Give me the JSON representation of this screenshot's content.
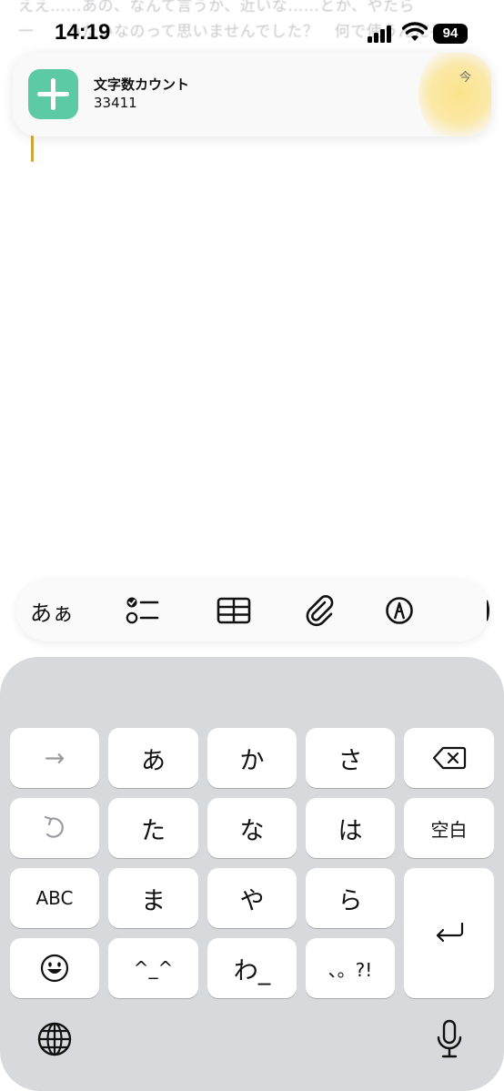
{
  "background_note": {
    "line1": "ええ……あの、なんて言うか、近いな……とか、やたら",
    "line2": "一　　みたいなのって思いませんでした？　何で使うんだろ",
    "line3": ""
  },
  "status_bar": {
    "time": "14:19",
    "battery": "94"
  },
  "notification": {
    "app_title": "文字数カウント",
    "body": "33411",
    "time": "今",
    "icon": "plus-icon"
  },
  "toolbar": {
    "text_format_label": "あぁ",
    "items": [
      "text-format",
      "checklist-icon",
      "table-icon",
      "paperclip-icon",
      "markup-icon",
      "more-icon"
    ]
  },
  "keyboard": {
    "row1": [
      "→",
      "あ",
      "か",
      "さ",
      "⌫"
    ],
    "row2": [
      "↶",
      "た",
      "な",
      "は",
      "空白"
    ],
    "row3": [
      "ABC",
      "ま",
      "や",
      "ら"
    ],
    "row4": [
      "☺",
      "^_^",
      "わ_",
      "、。?!"
    ],
    "enter_icon": "return-icon",
    "globe_icon": "globe-icon",
    "mic_icon": "microphone-icon"
  },
  "colors": {
    "app_icon": "#5ccaa4",
    "caret": "#d4a73a",
    "keyboard_bg": "#d8d9dd"
  }
}
